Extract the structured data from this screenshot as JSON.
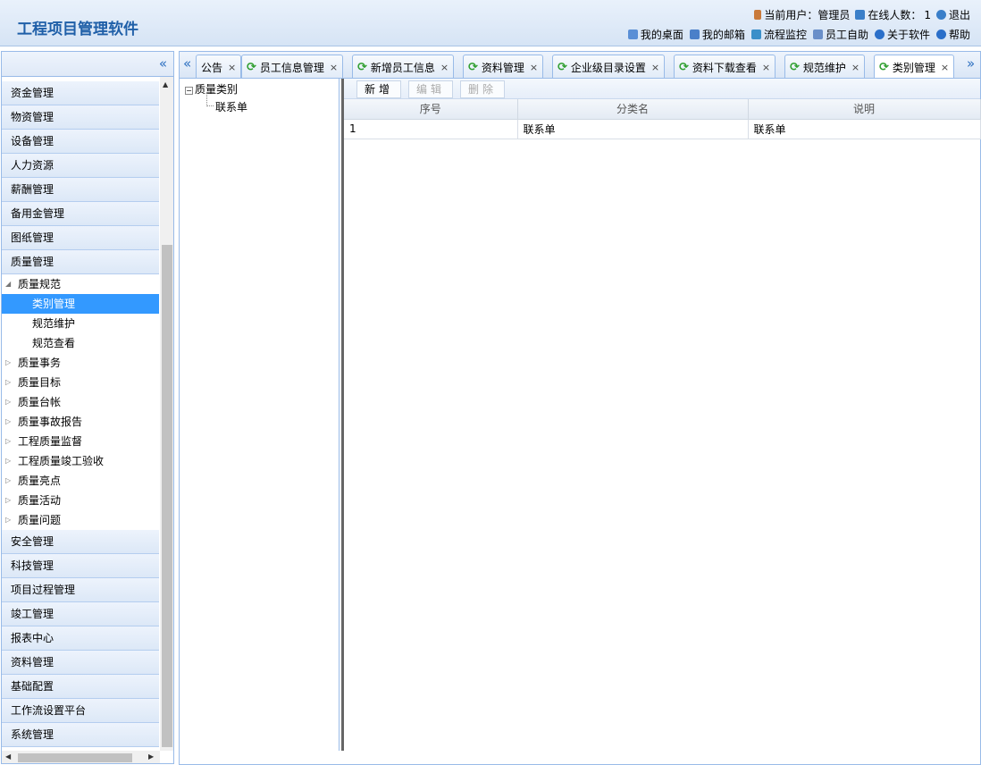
{
  "header": {
    "title": "工程项目管理软件",
    "current_user_label": "当前用户：管理员",
    "online_label": "在线人数：",
    "online_count": "1",
    "logout": "退出",
    "links": [
      {
        "label": "我的桌面",
        "icon": "home-icon"
      },
      {
        "label": "我的邮箱",
        "icon": "mail-icon"
      },
      {
        "label": "流程监控",
        "icon": "process-icon"
      },
      {
        "label": "员工自助",
        "icon": "person-icon"
      },
      {
        "label": "关于软件",
        "icon": "info-icon"
      },
      {
        "label": "帮助",
        "icon": "help-icon"
      }
    ]
  },
  "sidebar": {
    "collapse_glyph": "«",
    "accordion_top": [
      "资金管理",
      "物资管理",
      "设备管理",
      "人力资源",
      "薪酬管理",
      "备用金管理",
      "图纸管理",
      "质量管理"
    ],
    "tree": {
      "group": "质量规范",
      "children": [
        "类别管理",
        "规范维护",
        "规范查看"
      ],
      "selected": "类别管理",
      "collapsed_groups": [
        "质量事务",
        "质量目标",
        "质量台帐",
        "质量事故报告",
        "工程质量监督",
        "工程质量竣工验收",
        "质量亮点",
        "质量活动",
        "质量问题"
      ]
    },
    "accordion_bottom": [
      "安全管理",
      "科技管理",
      "项目过程管理",
      "竣工管理",
      "报表中心",
      "资料管理",
      "基础配置",
      "工作流设置平台",
      "系统管理"
    ]
  },
  "tabs": {
    "items": [
      {
        "label": "公告",
        "refresh": false
      },
      {
        "label": "员工信息管理",
        "refresh": true
      },
      {
        "label": "新增员工信息",
        "refresh": true
      },
      {
        "label": "资料管理",
        "refresh": true
      },
      {
        "label": "企业级目录设置",
        "refresh": true
      },
      {
        "label": "资料下载查看",
        "refresh": true
      },
      {
        "label": "规范维护",
        "refresh": true
      },
      {
        "label": "类别管理",
        "refresh": true
      }
    ],
    "active": "类别管理",
    "close_glyph": "×",
    "refresh_glyph": "⟳"
  },
  "content": {
    "tree_root": "质量类别",
    "tree_child": "联系单",
    "toolbar": {
      "add": "新增",
      "edit": "编辑",
      "delete": "删除"
    },
    "columns": [
      "序号",
      "分类名",
      "说明"
    ],
    "rows": [
      [
        "1",
        "联系单",
        "联系单"
      ]
    ]
  },
  "colors": {
    "accent": "#3399ff",
    "title": "#1f5fa8",
    "border": "#99bbe8"
  }
}
